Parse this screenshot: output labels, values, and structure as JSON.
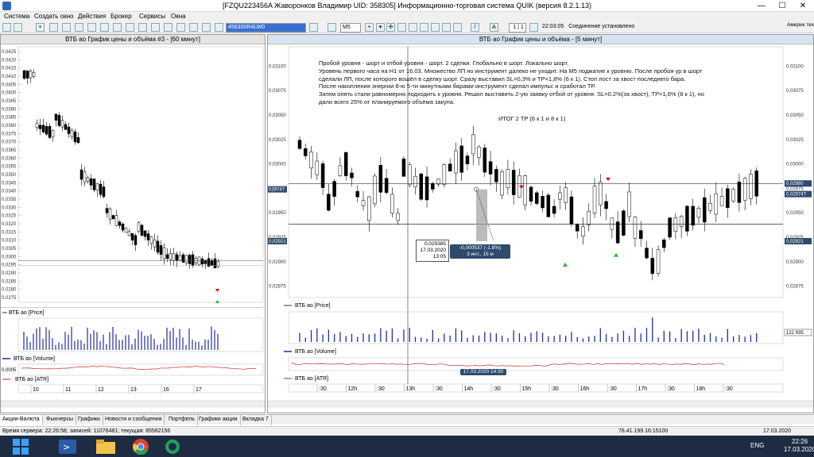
{
  "window": {
    "title": "[FZQU223456A Жаворонков Владимир UID: 358305] Информационно-торговая система QUIK (версия 8.2.1.13)",
    "minimize": "—",
    "maximize": "☐",
    "close": "✕"
  },
  "menu": [
    "Система",
    "Создать окно",
    "Действия",
    "Брокер",
    "Сервисы",
    "Окна"
  ],
  "toolbar": {
    "account": "456300R4LW0",
    "interval": "M5",
    "page": "1 | 1",
    "time": "22:03:05",
    "connection": "Соединение установлено",
    "right_label": "Америк тех"
  },
  "left_chart": {
    "title": "ВТБ ао График цены и объёма #3 - [60 минут]",
    "price_label": "ВТБ ао [Price]",
    "volume_label": "ВТБ ао [Volume]",
    "atr_label": "ВТБ ао [ATR]",
    "atr_value": "0,0005",
    "yticks": [
      "0,0425",
      "0,0420",
      "0,0415",
      "0,0410",
      "0,0405",
      "0,0400",
      "0,0395",
      "0,0390",
      "0,0385",
      "0,0380",
      "0,0375",
      "0,0370",
      "0,0365",
      "0,0360",
      "0,0355",
      "0,0350",
      "0,0345",
      "0,0340",
      "0,0335",
      "0,0330",
      "0,0325",
      "0,0320",
      "0,0315",
      "0,0310",
      "0,0305",
      "0,0300",
      "0,0295",
      "0,0290",
      "0,0285",
      "0,0280",
      "0,0275"
    ],
    "xticks": [
      "10",
      "11",
      "12",
      "13",
      "16",
      "17"
    ]
  },
  "right_chart": {
    "title": "ВТБ ао График цены и объёма - [5 минут]",
    "price_label": "ВТБ ао [Price]",
    "volume_label": "ВТБ ао [Volume]",
    "atr_label": "ВТБ ао [ATR]",
    "volume_value": "122 935",
    "yticks": [
      "0,03100",
      "0,03075",
      "0,03050",
      "0,03025",
      "0,03000",
      "0,02975",
      "0,02950",
      "0,02925",
      "0,02900",
      "0,02875"
    ],
    "left_marks": [
      "02974?",
      "0,02921"
    ],
    "right_marks": [
      "0,02980",
      "0,02974?",
      "0,02921"
    ],
    "xticks": [
      ":30",
      "12h",
      ":30",
      "13h",
      ":30",
      "14h",
      ":30",
      "15h",
      ":30",
      "16h",
      ":30",
      "17h",
      ":30",
      "18h",
      ":30"
    ],
    "cursor_date": "17.03.2020 14",
    "cursor_date2": "17.03.2020 14:30",
    "tooltip1": [
      "0,029385",
      "17.03.2020",
      "13:05"
    ],
    "tooltip2": [
      "-0,000537 (-1.8%)",
      "3 инт., 15 м"
    ],
    "notes": [
      "Пробой уровня - шорт и отбой уровня - шорт. 2 сделки. Глобально в шорт. Локально шорт.",
      "Уровень первого часа на H1 от 16.03. Множество ЛП но инструмент далеко не уходит. На M5 поджатие к уровню. После пробоя ур в шорт",
      "сделали ЛП, после которого вошёл в сделку шорт. Сразу выставил SL=0,3% и TP=1,8% (6 к 1). Стоп лост за хвост последнего бара.",
      "После накопления энергии 8-ю 5-ти минутными барами инструмент сделал импульс и сработал TP.",
      "Затем опять стали равномерно подходить к уровня. Решил выставить 2-ую заявку отбой от уровня. SL=0.2%(за хвост), TP=1,6% (8 к 1), но",
      "дали всего 25% от планируемого объёма закупа."
    ],
    "summary": "ИТОГ 2 TP (6 к 1 и 8 к 1)"
  },
  "tabs": [
    "Акции-Валюта",
    "Фьючерсы",
    "Графики",
    "Новости и сообщения",
    "Портфель",
    "Графики акции",
    "Вкладка 7"
  ],
  "status": {
    "server_time": "Время сервера: 22:26:58; записей: 11076481; текущая: 85562156",
    "ip": "78.41.199.16:15100",
    "date": "17.03.2020"
  },
  "taskbar": {
    "lang": "ENG",
    "time": "22:26",
    "date": "17.03.2020"
  },
  "colors": {
    "bull": "#ffffff",
    "bear": "#000000",
    "volume": "#1f2f9a",
    "atr": "#cc2a2a",
    "arrow_down": "#dd0000",
    "arrow_up": "#22bb22",
    "hline": "#3a5a8a"
  }
}
